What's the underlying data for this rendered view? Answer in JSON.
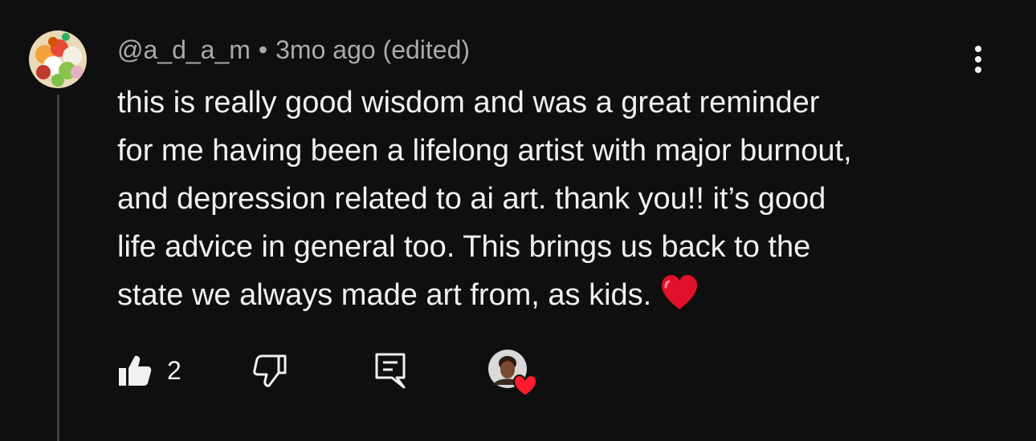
{
  "comment": {
    "author": "@a_d_a_m",
    "separator": "•",
    "timestamp": "3mo ago",
    "edited_label": "(edited)",
    "text": "this is really good wisdom and was a great reminder\nfor me having been a lifelong artist with major burnout,\nand depression related to ai art. thank you!! it’s good\nlife advice in general too. This brings us back to the\nstate we always made art from, as kids.",
    "emoji": "red-heart"
  },
  "actions": {
    "like_count": "2",
    "like_icon": "thumb-up-icon",
    "dislike_icon": "thumb-down-icon",
    "reply_icon": "comment-reply-icon",
    "creator_heart_icon": "creator-heart-icon"
  },
  "menu": {
    "icon": "more-vertical-icon"
  },
  "colors": {
    "background": "#0f0f0f",
    "text_primary": "#f1f1f1",
    "text_secondary": "#aaaaaa",
    "thread_line": "#3f3f3f",
    "heart": "#ff1a2d"
  }
}
